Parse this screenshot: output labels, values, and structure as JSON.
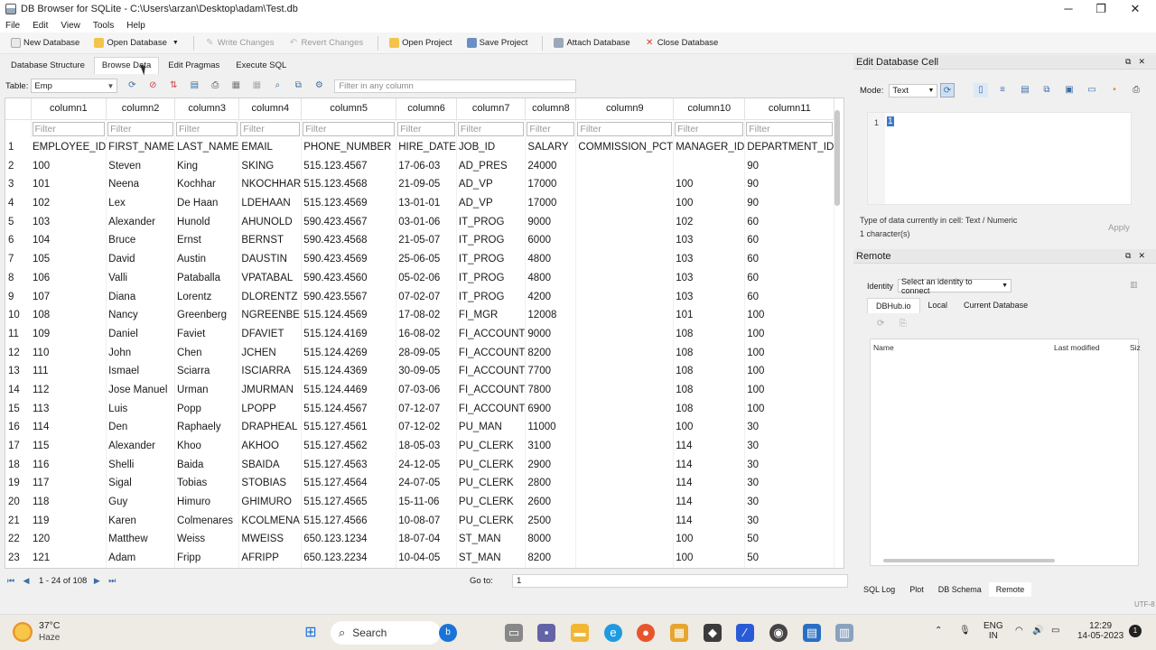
{
  "window": {
    "title": "DB Browser for SQLite - C:\\Users\\arzan\\Desktop\\adam\\Test.db",
    "minimize": "─",
    "maximize": "❐",
    "close": "✕"
  },
  "menu": [
    "File",
    "Edit",
    "View",
    "Tools",
    "Help"
  ],
  "toolbar": {
    "new_database": "New Database",
    "open_database": "Open Database",
    "write_changes": "Write Changes",
    "revert_changes": "Revert Changes",
    "open_project": "Open Project",
    "save_project": "Save Project",
    "attach_database": "Attach Database",
    "close_database": "Close Database"
  },
  "tabs": [
    "Database Structure",
    "Browse Data",
    "Edit Pragmas",
    "Execute SQL"
  ],
  "active_tab": "Browse Data",
  "browse": {
    "table_label": "Table:",
    "table_value": "Emp",
    "filter_placeholder": "Filter in any column",
    "column_filter_placeholder": "Filter"
  },
  "grid": {
    "columns": [
      "column1",
      "column2",
      "column3",
      "column4",
      "column5",
      "column6",
      "column7",
      "column8",
      "column9",
      "column10",
      "column11"
    ],
    "rows": [
      [
        "1",
        "EMPLOYEE_ID",
        "FIRST_NAME",
        "LAST_NAME",
        "EMAIL",
        "PHONE_NUMBER",
        "HIRE_DATE",
        "JOB_ID",
        "SALARY",
        "COMMISSION_PCT",
        "MANAGER_ID",
        "DEPARTMENT_ID"
      ],
      [
        "2",
        "100",
        "Steven",
        "King",
        "SKING",
        "515.123.4567",
        "17-06-03",
        "AD_PRES",
        "24000",
        "",
        "",
        "90"
      ],
      [
        "3",
        "101",
        "Neena",
        "Kochhar",
        "NKOCHHAR",
        "515.123.4568",
        "21-09-05",
        "AD_VP",
        "17000",
        "",
        "100",
        "90"
      ],
      [
        "4",
        "102",
        "Lex",
        "De Haan",
        "LDEHAAN",
        "515.123.4569",
        "13-01-01",
        "AD_VP",
        "17000",
        "",
        "100",
        "90"
      ],
      [
        "5",
        "103",
        "Alexander",
        "Hunold",
        "AHUNOLD",
        "590.423.4567",
        "03-01-06",
        "IT_PROG",
        "9000",
        "",
        "102",
        "60"
      ],
      [
        "6",
        "104",
        "Bruce",
        "Ernst",
        "BERNST",
        "590.423.4568",
        "21-05-07",
        "IT_PROG",
        "6000",
        "",
        "103",
        "60"
      ],
      [
        "7",
        "105",
        "David",
        "Austin",
        "DAUSTIN",
        "590.423.4569",
        "25-06-05",
        "IT_PROG",
        "4800",
        "",
        "103",
        "60"
      ],
      [
        "8",
        "106",
        "Valli",
        "Pataballa",
        "VPATABAL",
        "590.423.4560",
        "05-02-06",
        "IT_PROG",
        "4800",
        "",
        "103",
        "60"
      ],
      [
        "9",
        "107",
        "Diana",
        "Lorentz",
        "DLORENTZ",
        "590.423.5567",
        "07-02-07",
        "IT_PROG",
        "4200",
        "",
        "103",
        "60"
      ],
      [
        "10",
        "108",
        "Nancy",
        "Greenberg",
        "NGREENBE",
        "515.124.4569",
        "17-08-02",
        "FI_MGR",
        "12008",
        "",
        "101",
        "100"
      ],
      [
        "11",
        "109",
        "Daniel",
        "Faviet",
        "DFAVIET",
        "515.124.4169",
        "16-08-02",
        "FI_ACCOUNT",
        "9000",
        "",
        "108",
        "100"
      ],
      [
        "12",
        "110",
        "John",
        "Chen",
        "JCHEN",
        "515.124.4269",
        "28-09-05",
        "FI_ACCOUNT",
        "8200",
        "",
        "108",
        "100"
      ],
      [
        "13",
        "111",
        "Ismael",
        "Sciarra",
        "ISCIARRA",
        "515.124.4369",
        "30-09-05",
        "FI_ACCOUNT",
        "7700",
        "",
        "108",
        "100"
      ],
      [
        "14",
        "112",
        "Jose Manuel",
        "Urman",
        "JMURMAN",
        "515.124.4469",
        "07-03-06",
        "FI_ACCOUNT",
        "7800",
        "",
        "108",
        "100"
      ],
      [
        "15",
        "113",
        "Luis",
        "Popp",
        "LPOPP",
        "515.124.4567",
        "07-12-07",
        "FI_ACCOUNT",
        "6900",
        "",
        "108",
        "100"
      ],
      [
        "16",
        "114",
        "Den",
        "Raphaely",
        "DRAPHEAL",
        "515.127.4561",
        "07-12-02",
        "PU_MAN",
        "11000",
        "",
        "100",
        "30"
      ],
      [
        "17",
        "115",
        "Alexander",
        "Khoo",
        "AKHOO",
        "515.127.4562",
        "18-05-03",
        "PU_CLERK",
        "3100",
        "",
        "114",
        "30"
      ],
      [
        "18",
        "116",
        "Shelli",
        "Baida",
        "SBAIDA",
        "515.127.4563",
        "24-12-05",
        "PU_CLERK",
        "2900",
        "",
        "114",
        "30"
      ],
      [
        "19",
        "117",
        "Sigal",
        "Tobias",
        "STOBIAS",
        "515.127.4564",
        "24-07-05",
        "PU_CLERK",
        "2800",
        "",
        "114",
        "30"
      ],
      [
        "20",
        "118",
        "Guy",
        "Himuro",
        "GHIMURO",
        "515.127.4565",
        "15-11-06",
        "PU_CLERK",
        "2600",
        "",
        "114",
        "30"
      ],
      [
        "21",
        "119",
        "Karen",
        "Colmenares",
        "KCOLMENA",
        "515.127.4566",
        "10-08-07",
        "PU_CLERK",
        "2500",
        "",
        "114",
        "30"
      ],
      [
        "22",
        "120",
        "Matthew",
        "Weiss",
        "MWEISS",
        "650.123.1234",
        "18-07-04",
        "ST_MAN",
        "8000",
        "",
        "100",
        "50"
      ],
      [
        "23",
        "121",
        "Adam",
        "Fripp",
        "AFRIPP",
        "650.123.2234",
        "10-04-05",
        "ST_MAN",
        "8200",
        "",
        "100",
        "50"
      ]
    ]
  },
  "navigation": {
    "record_info": "1 - 24 of 108",
    "goto_label": "Go to:",
    "goto_value": "1"
  },
  "edit_cell": {
    "title": "Edit Database Cell",
    "mode_label": "Mode:",
    "mode_value": "Text",
    "line_number": "1",
    "cell_value": "1",
    "type_info": "Type of data currently in cell: Text / Numeric",
    "char_info": "1 character(s)",
    "apply": "Apply"
  },
  "remote": {
    "title": "Remote",
    "identity_label": "Identity",
    "identity_value": "Select an identity to connect",
    "tabs": [
      "DBHub.io",
      "Local",
      "Current Database"
    ],
    "columns": [
      "Name",
      "Last modified",
      "Siz"
    ]
  },
  "bottom_tabs": [
    "SQL Log",
    "Plot",
    "DB Schema",
    "Remote"
  ],
  "status": {
    "encoding": "UTF-8"
  },
  "taskbar": {
    "temperature": "37°C",
    "weather": "Haze",
    "search": "Search",
    "language_top": "ENG",
    "language_bottom": "IN",
    "time": "12:29",
    "date": "14-05-2023"
  },
  "colors": {
    "accent": "#3a6ea5",
    "selection": "#3a78c8",
    "close_red": "#d9362c"
  }
}
